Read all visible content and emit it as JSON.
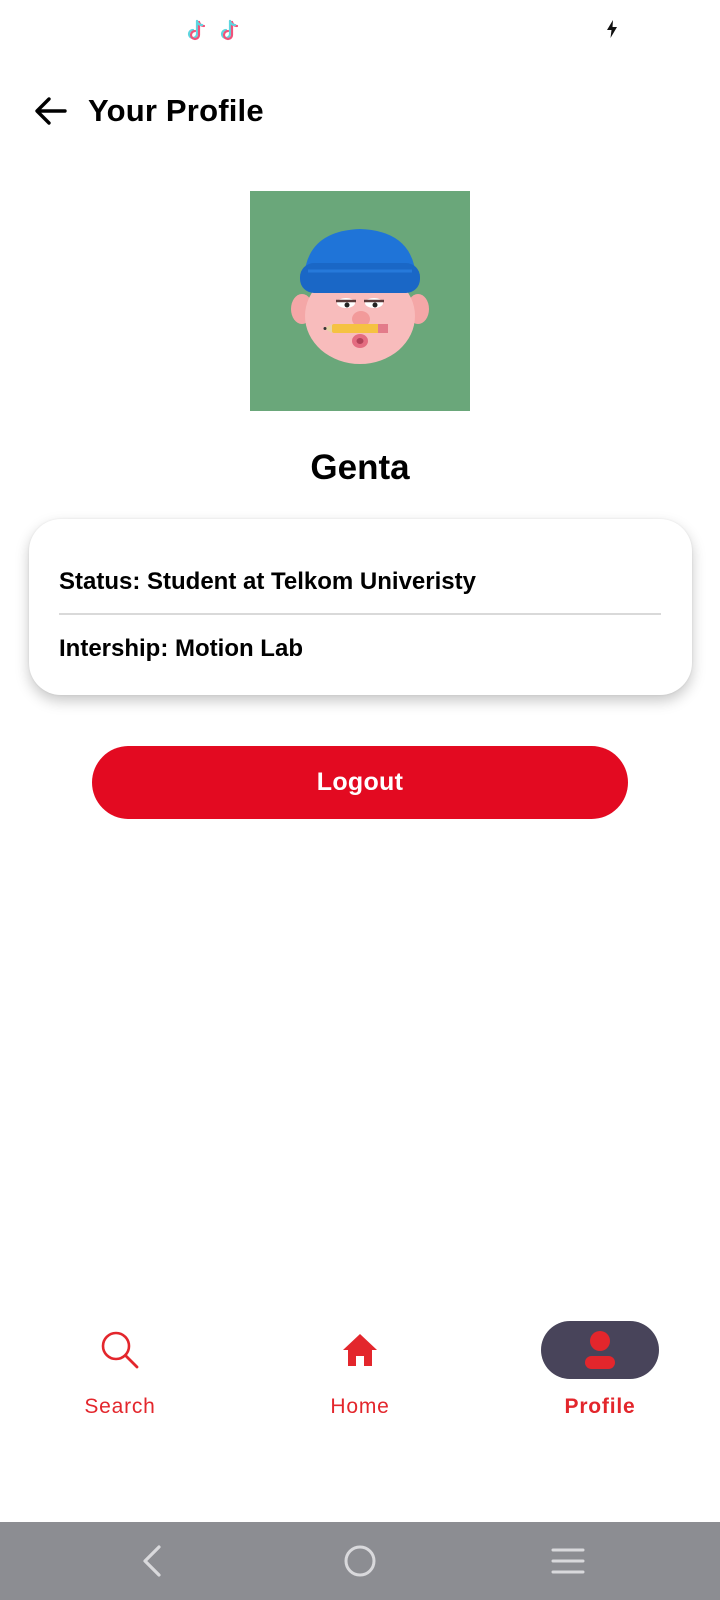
{
  "status_bar": {
    "icons": [
      "tiktok-icon",
      "tiktok-icon",
      "charging-bolt-icon"
    ]
  },
  "header": {
    "title": "Your Profile",
    "back_icon": "arrow-left-icon"
  },
  "profile": {
    "avatar_icon": "cartoon-avatar-beanie-pencil",
    "name": "Genta"
  },
  "info_card": {
    "status": "Status: Student at Telkom Univeristy",
    "internship": "Intership: Motion Lab"
  },
  "logout": {
    "label": "Logout",
    "color": "#e30a21"
  },
  "bottom_nav": {
    "items": [
      {
        "label": "Search",
        "icon": "search-icon",
        "active": false
      },
      {
        "label": "Home",
        "icon": "home-icon",
        "active": false
      },
      {
        "label": "Profile",
        "icon": "person-icon",
        "active": true
      }
    ],
    "accent_color": "#e3262c",
    "active_pill_color": "#48445a"
  },
  "system_nav": {
    "icons": [
      "back-chevron-icon",
      "home-circle-icon",
      "recents-menu-icon"
    ],
    "background": "#8c8d92"
  }
}
